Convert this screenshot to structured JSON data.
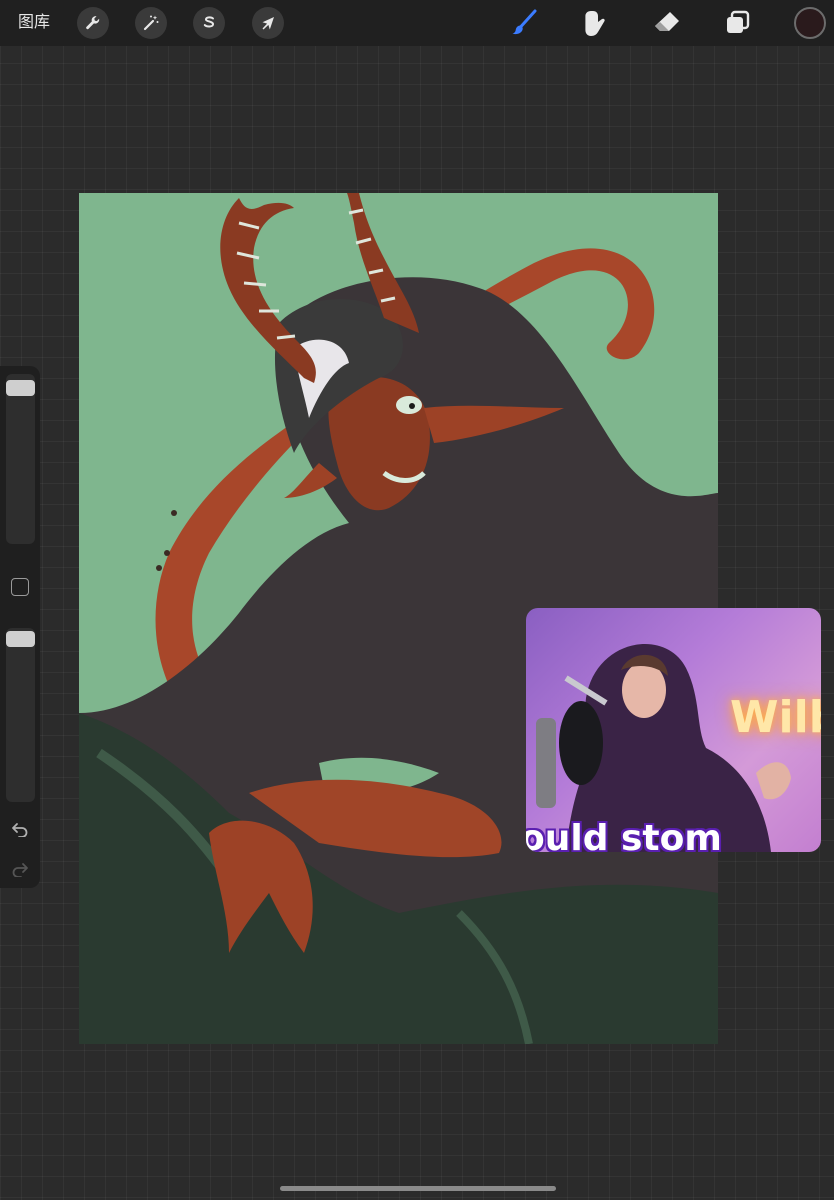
{
  "toolbar": {
    "gallery_label": "图库",
    "left_tools": [
      {
        "icon": "wrench-icon",
        "name": "actions"
      },
      {
        "icon": "magic-wand-icon",
        "name": "adjustments"
      },
      {
        "icon": "selection-s-icon",
        "name": "selection"
      },
      {
        "icon": "arrow-cursor-icon",
        "name": "transform"
      }
    ],
    "right_tools": [
      {
        "icon": "brush-icon",
        "name": "paint",
        "active": true
      },
      {
        "icon": "smudge-icon",
        "name": "smudge"
      },
      {
        "icon": "eraser-icon",
        "name": "erase"
      },
      {
        "icon": "layers-icon",
        "name": "layers"
      }
    ],
    "current_color": "#2a1a1c",
    "active_color": "#3b7cff"
  },
  "sidebar": {
    "brush_size_level": 0.04,
    "opacity_level": 0.02,
    "undo_icon": "undo-icon",
    "redo_icon": "redo-icon"
  },
  "canvas": {
    "background_color": "#7fb68e"
  },
  "pip": {
    "sign_text": "Wilbu",
    "caption_text": "ould stom"
  }
}
